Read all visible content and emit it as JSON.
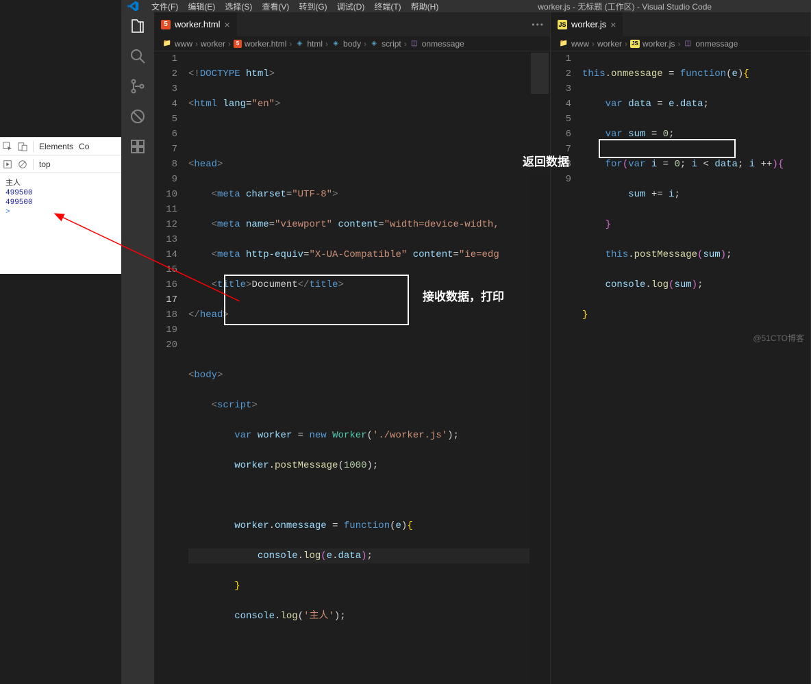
{
  "devtools": {
    "tabs": {
      "elements": "Elements",
      "co": "Co"
    },
    "top": "top",
    "console": {
      "line1": "主人",
      "line2": "499500",
      "line3": "499500",
      "prompt": ">"
    }
  },
  "menubar": {
    "file": "文件(F)",
    "edit": "编辑(E)",
    "select": "选择(S)",
    "view": "查看(V)",
    "goto": "转到(G)",
    "debug": "调试(D)",
    "terminal": "终端(T)",
    "help": "帮助(H)",
    "title": "worker.js - 无标题 (工作区) - Visual Studio Code"
  },
  "group1": {
    "tab": {
      "label": "worker.html"
    },
    "actions": "•••",
    "breadcrumbs": [
      "www",
      "worker",
      "worker.html",
      "html",
      "body",
      "script",
      "onmessage"
    ],
    "lines": {
      "1": "<!DOCTYPE html>",
      "2": "<html lang=\"en\">",
      "3": "",
      "4": "<head>",
      "5": "    <meta charset=\"UTF-8\">",
      "6": "    <meta name=\"viewport\" content=\"width=device-width,",
      "7": "    <meta http-equiv=\"X-UA-Compatible\" content=\"ie=edg",
      "8": "    <title>Document</title>",
      "9": "</head>",
      "10": "",
      "11": "<body>",
      "12": "    <script>",
      "13": "        var worker = new Worker('./worker.js');",
      "14": "        worker.postMessage(1000);",
      "15": "",
      "16": "        worker.onmessage = function(e){",
      "17": "            console.log(e.data);",
      "18": "        }",
      "19": "        console.log('主人');",
      "20": ""
    }
  },
  "group2": {
    "tab": {
      "label": "worker.js"
    },
    "breadcrumbs": [
      "www",
      "worker",
      "worker.js",
      "onmessage"
    ],
    "lines": {
      "1": "this.onmessage = function(e){",
      "2": "    var data = e.data;",
      "3": "    var sum = 0;",
      "4": "    for(var i = 0; i < data; i ++){",
      "5": "        sum += i;",
      "6": "    }",
      "7": "    this.postMessage(sum);",
      "8": "    console.log(sum);",
      "9": "}"
    }
  },
  "annotations": {
    "label1": "接收数据，打印",
    "label2": "返回数据"
  },
  "watermark": "@51CTO博客"
}
